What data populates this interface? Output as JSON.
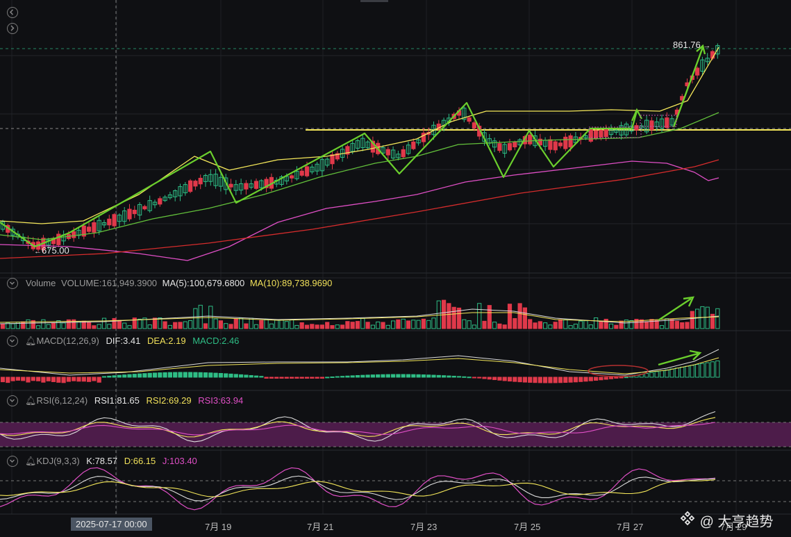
{
  "nav": {
    "collapse_icon": "chevron-left-icon",
    "expand_icon": "chevron-right-icon"
  },
  "price": {
    "high_label": "861.76",
    "low_label": "675.00",
    "high_arrow": "→",
    "low_arrow": "←"
  },
  "volume": {
    "title": "Volume",
    "vol": "VOLUME:161,949.3900",
    "ma5": "MA(5):100,679.6800",
    "ma10": "MA(10):89,738.9690"
  },
  "macd": {
    "title": "MACD(12,26,9)",
    "dif": "DIF:3.41",
    "dea": "DEA:2.19",
    "macd": "MACD:2.46"
  },
  "rsi": {
    "title": "RSI(6,12,24)",
    "rsi1": "RSI1:81.65",
    "rsi2": "RSI2:69.29",
    "rsi3": "RSI3:63.94"
  },
  "kdj": {
    "title": "KDJ(9,3,3)",
    "k": "K:78.57",
    "d": "D:66.15",
    "j": "J:103.40"
  },
  "xaxis": {
    "cursor": "2025-07-17 00:00",
    "ticks": [
      "7月 19",
      "7月 21",
      "7月 23",
      "7月 25",
      "7月 27",
      "7月 29"
    ]
  },
  "watermark": {
    "text": "@ 大亨趋势"
  },
  "colors": {
    "up": "#2ebd85",
    "down": "#e0394a",
    "ma_yellow": "#f5e85a",
    "ma_green": "#63c13b",
    "ma_pink": "#e04fc6",
    "ma_red": "#d62c2c",
    "arrow": "#6bcf2d"
  }
}
